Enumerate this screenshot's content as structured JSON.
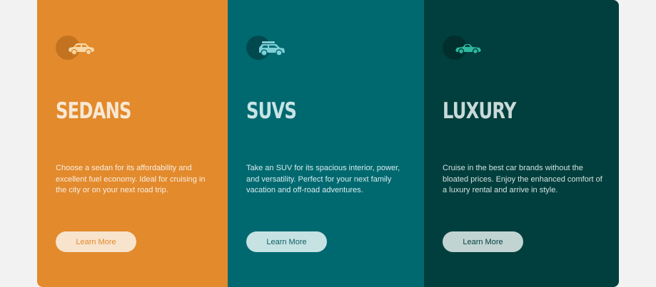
{
  "cards": [
    {
      "title": "SEDANS",
      "description": "Choose a sedan for its affordability and excellent fuel economy. Ideal for cruising in the city or on your next road trip.",
      "button": "Learn More",
      "icon": "sedan-car-icon",
      "bg": "#e28a2c"
    },
    {
      "title": "SUVS",
      "description": "Take an SUV for its spacious interior, power, and versatility. Perfect for your next family vacation and off-road adventures.",
      "button": "Learn More",
      "icon": "suv-car-icon",
      "bg": "#006970"
    },
    {
      "title": "LUXURY",
      "description": "Cruise in the best car brands without the bloated prices. Enjoy the enhanced comfort of a luxury rental and arrive in style.",
      "button": "Learn More",
      "icon": "luxury-car-icon",
      "bg": "#003f3d"
    }
  ]
}
